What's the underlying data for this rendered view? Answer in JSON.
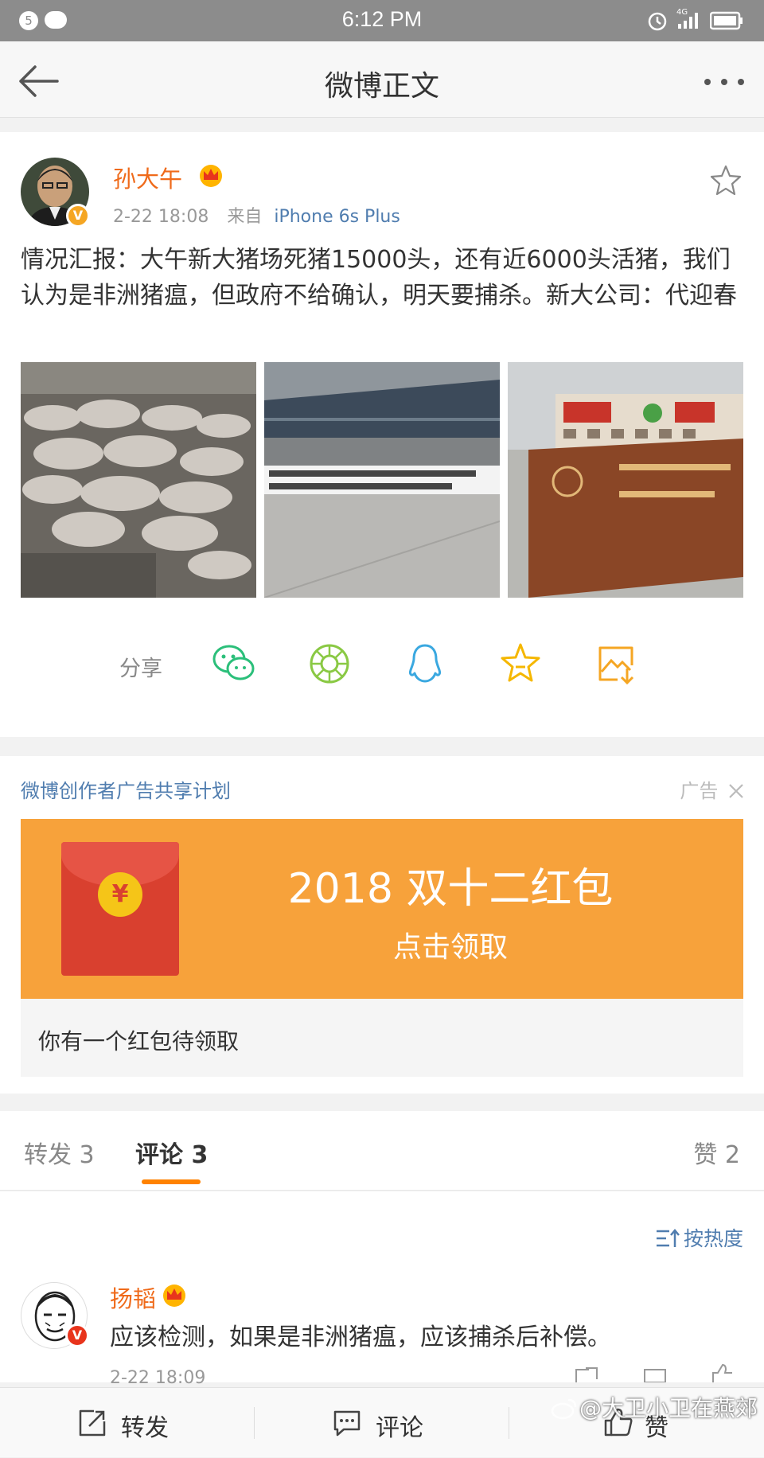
{
  "status_bar": {
    "notification_count": "5",
    "time": "6:12 PM",
    "network": "4G"
  },
  "nav": {
    "title": "微博正文"
  },
  "post": {
    "author": "孙大午",
    "time": "2-22 18:08",
    "source_prefix": "来自",
    "source": "iPhone 6s Plus",
    "text": "情况汇报：大午新大猪场死猪15000头，还有近6000头活猪，我们认为是非洲猪瘟，但政府不给确认，明天要捕杀。新大公司：代迎春",
    "images": [
      "dead-pigs-photo",
      "banner-protest-photo",
      "company-sign-photo"
    ],
    "share_label": "分享",
    "share_targets": [
      "wechat-icon",
      "moments-icon",
      "qq-icon",
      "favorite-star-icon",
      "save-image-icon"
    ]
  },
  "ad": {
    "plan_label": "微博创作者广告共享计划",
    "tag": "广告",
    "banner_title": "2018 双十二红包",
    "banner_subtitle": "点击领取",
    "coin_symbol": "¥",
    "caption": "你有一个红包待领取"
  },
  "tabs": {
    "repost": "转发 3",
    "comment": "评论 3",
    "like": "赞 2"
  },
  "comments": {
    "sort_label": "按热度",
    "items": [
      {
        "author": "扬韬",
        "text": "应该检测，如果是非洲猪瘟，应该捕杀后补偿。",
        "time": "2-22 18:09"
      }
    ]
  },
  "toolbar": {
    "repost": "转发",
    "comment": "评论",
    "like": "赞"
  },
  "watermark": "@大卫小卫在燕郊",
  "colors": {
    "accent": "#ff8200",
    "link": "#507daf",
    "username": "#ef6a1a",
    "ad_banner": "#f7a23b"
  }
}
